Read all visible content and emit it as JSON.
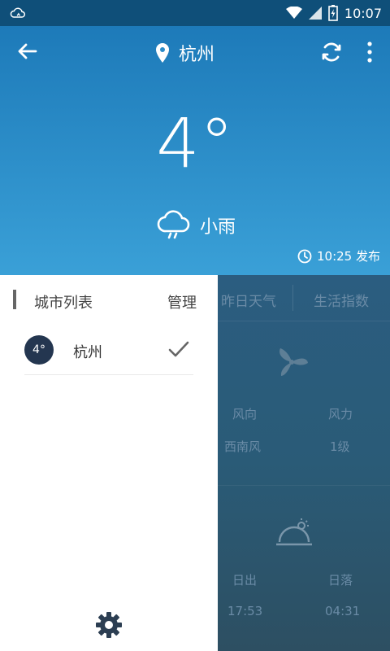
{
  "status_bar": {
    "time": "10:07"
  },
  "header": {
    "city": "杭州",
    "temperature": "4°",
    "condition": "小雨",
    "publish_time": "10:25 发布"
  },
  "tabs": {
    "yesterday": "昨日天气",
    "life_index": "生活指数"
  },
  "details": {
    "wind_direction_label": "风向",
    "wind_direction_value": "西南风",
    "wind_force_label": "风力",
    "wind_force_value": "1级",
    "sunrise_label": "日出",
    "sunrise_value": "17:53",
    "sunset_label": "日落",
    "sunset_value": "04:31"
  },
  "drawer": {
    "title": "城市列表",
    "manage": "管理",
    "cities": [
      {
        "temp_badge": "4°",
        "name": "杭州",
        "selected": true
      }
    ]
  },
  "colors": {
    "accent_blue": "#1d7ab9",
    "status_bar": "#0f4f79",
    "badge_dark": "#243650"
  },
  "icons": {
    "back": "arrow-left-icon",
    "location": "location-pin-icon",
    "refresh": "refresh-icon",
    "more": "more-vertical-icon",
    "weather": "cloud-rain-icon",
    "clock": "clock-icon",
    "settings": "gear-icon"
  }
}
